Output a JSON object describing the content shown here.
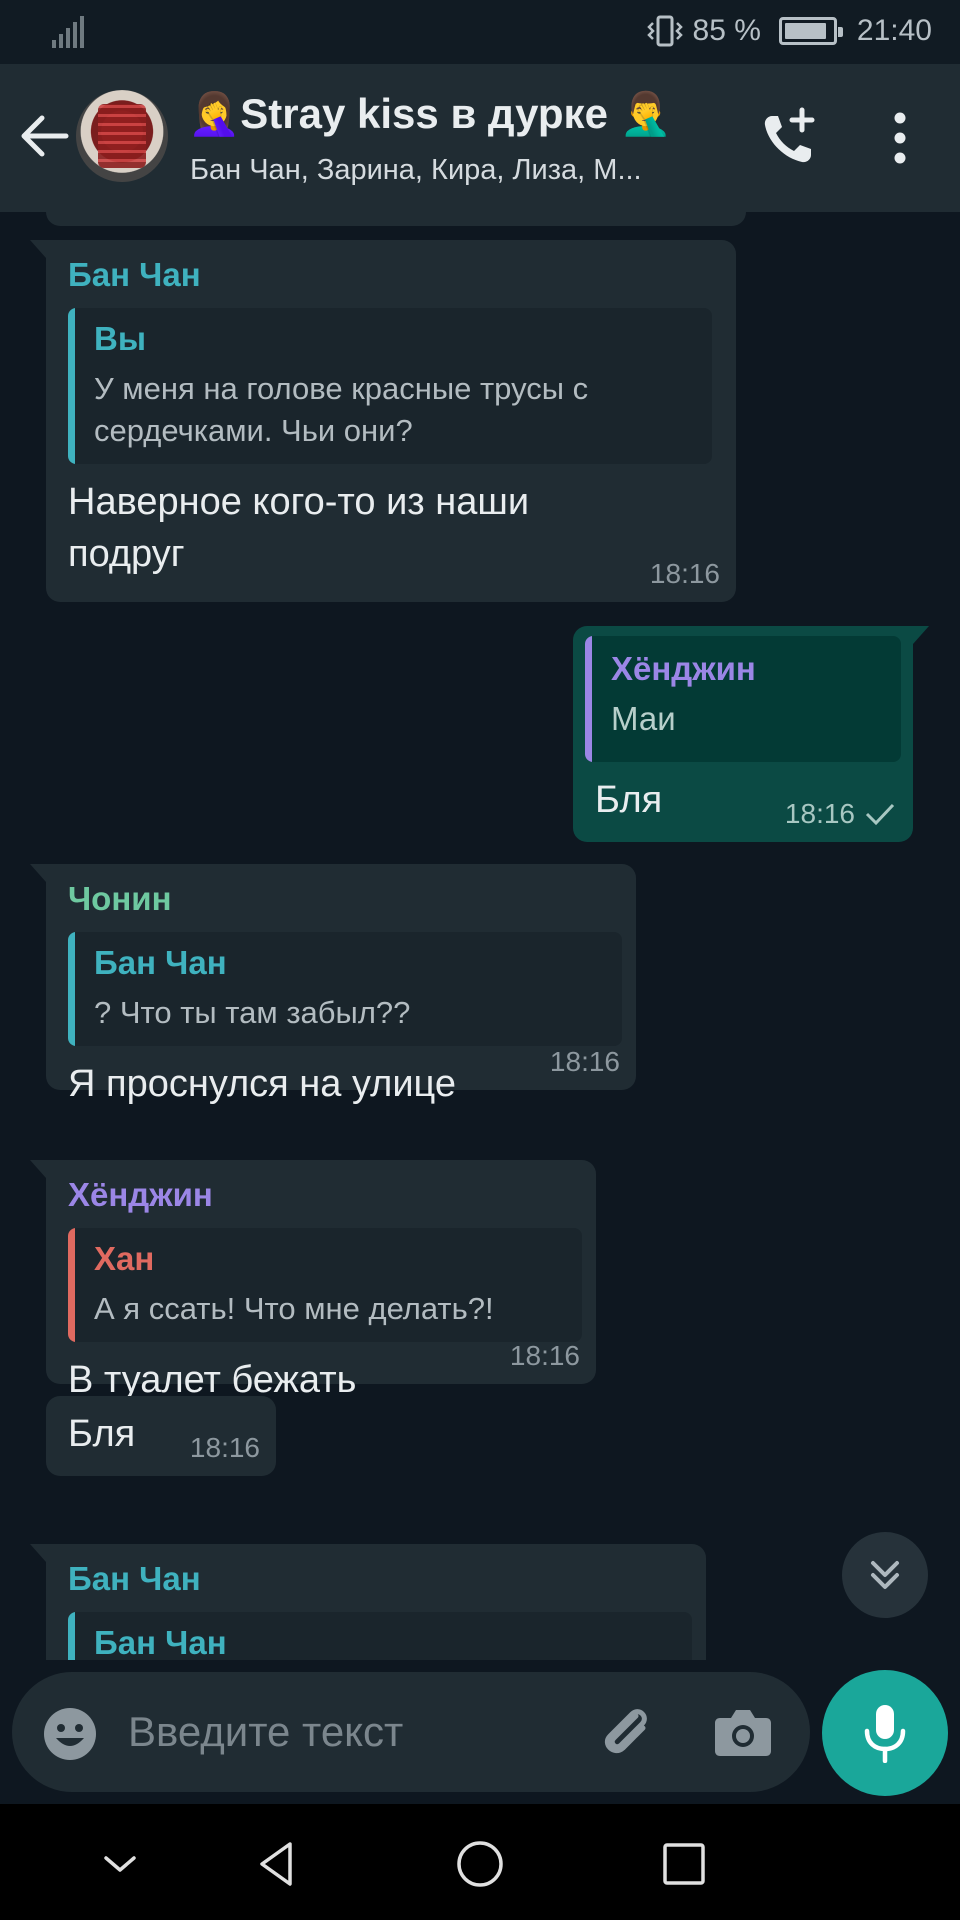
{
  "status_bar": {
    "battery_text": "85 %",
    "battery_level": 0.85,
    "time": "21:40"
  },
  "header": {
    "title": "🤦‍♀️Stray kiss в дурке 🤦‍♂️",
    "subtitle": "Бан Чан, Зарина, Кира, Лиза, М..."
  },
  "messages": [
    {
      "sender": "Бан Чан",
      "quote": {
        "author": "Вы",
        "text": "У меня на голове красные трусы с сердечками. Чьи они?"
      },
      "text": "Наверное кого-то из наши подруг",
      "time": "18:16"
    },
    {
      "quote": {
        "author": "Хёнджин",
        "text": "Маи"
      },
      "text": "Бля",
      "time": "18:16"
    },
    {
      "sender": "Чонин",
      "quote": {
        "author": "Бан Чан",
        "text": "? Что ты там забыл??"
      },
      "text": "Я проснулся на улице",
      "time": "18:16"
    },
    {
      "sender": "Хёнджин",
      "quote": {
        "author": "Хан",
        "text": "А я ссать! Что мне делать?!"
      },
      "text": "В туалет бежать",
      "time": "18:16"
    },
    {
      "text": "Бля",
      "time": "18:16"
    },
    {
      "sender": "Бан Чан",
      "quote": {
        "author": "Бан Чан",
        "text": ""
      }
    }
  ],
  "input": {
    "placeholder": "Введите текст"
  },
  "colors": {
    "background": "#0e1720",
    "header": "#202c33",
    "incoming_bubble": "#202c33",
    "outgoing_bubble": "#0b4a44",
    "accent": "#1aa79a",
    "sender_teal": "#3fb2bf",
    "sender_green": "#6ec9a0",
    "sender_purple": "#9b86e6",
    "sender_red": "#e06a60"
  },
  "icons": [
    "signal-icon",
    "vibrate-icon",
    "battery-icon",
    "back-arrow-icon",
    "group-avatar",
    "add-call-icon",
    "more-vert-icon",
    "read-check-icon",
    "scroll-down-icon",
    "emoji-icon",
    "attach-icon",
    "camera-icon",
    "mic-icon",
    "nav-collapse-icon",
    "nav-back-icon",
    "nav-home-icon",
    "nav-recents-icon"
  ]
}
